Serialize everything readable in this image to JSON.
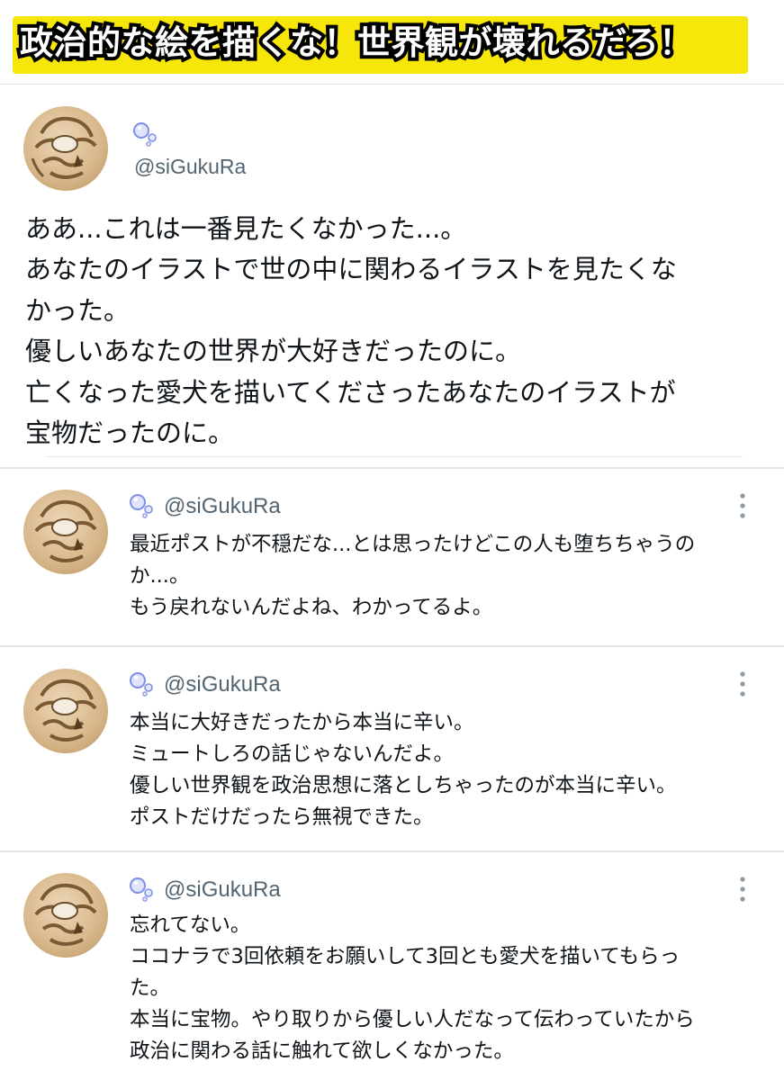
{
  "banner": {
    "text": "政治的な絵を描くな！世界観が壊れるだろ！",
    "color": "#f6e60a"
  },
  "main_post": {
    "handle": "@siGukuRa",
    "avatar_icon": "avatar-image",
    "name_icon": "bubbles-icon",
    "lines": [
      "ああ...これは一番見たくなかった...。",
      "あなたのイラストで世の中に関わるイラストを見たくな",
      "かった。",
      "優しいあなたの世界が大好きだったのに。",
      "亡くなった愛犬を描いてくださったあなたのイラストが",
      "宝物だったのに。"
    ]
  },
  "replies": [
    {
      "handle": "@siGukuRa",
      "more_icon": "more-vertical-icon",
      "lines": [
        "最近ポストが不穏だな...とは思ったけどこの人も堕ちちゃうの",
        "か...。",
        "もう戻れないんだよね、わかってるよ。"
      ]
    },
    {
      "handle": "@siGukuRa",
      "more_icon": "more-vertical-icon",
      "lines": [
        "本当に大好きだったから本当に辛い。",
        "ミュートしろの話じゃないんだよ。",
        "優しい世界観を政治思想に落としちゃったのが本当に辛い。",
        "ポストだけだったら無視できた。"
      ]
    },
    {
      "handle": "@siGukuRa",
      "more_icon": "more-vertical-icon",
      "lines": [
        "忘れてない。",
        "ココナラで3回依頼をお願いして3回とも愛犬を描いてもらっ",
        "た。",
        "本当に宝物。やり取りから優しい人だなって伝わっていたから",
        "政治に関わる話に触れて欲しくなかった。"
      ]
    }
  ]
}
